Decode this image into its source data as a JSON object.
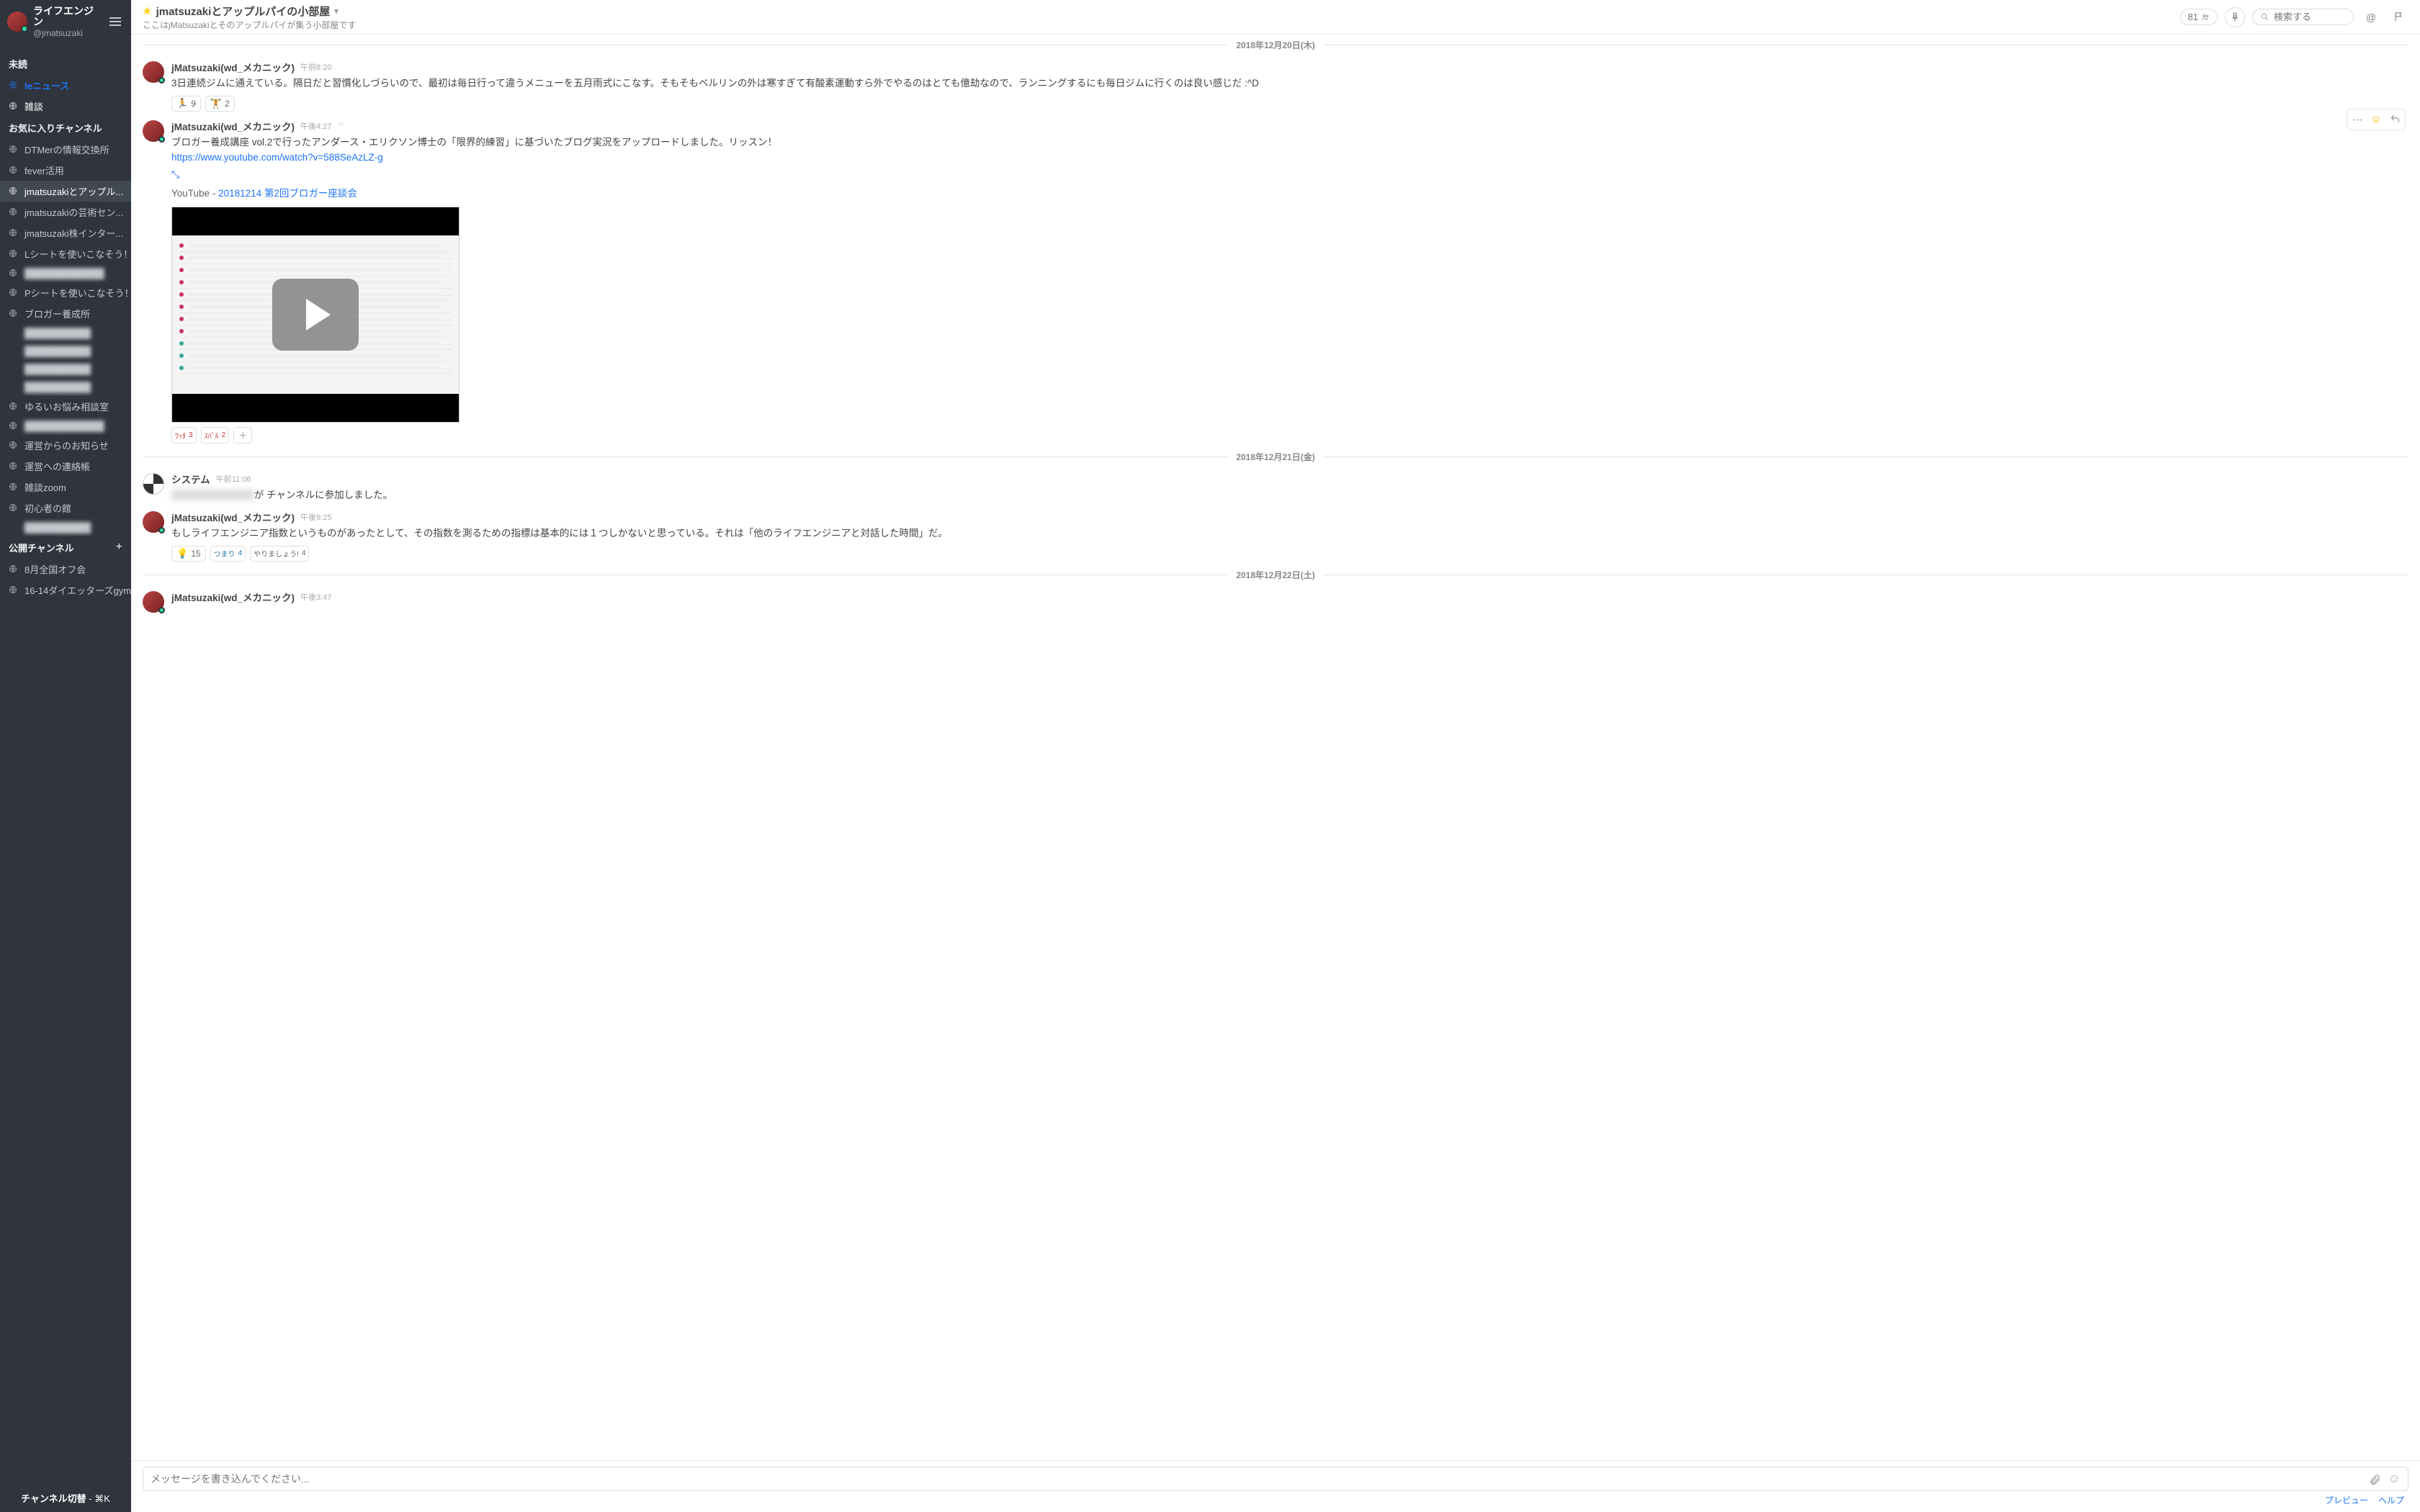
{
  "workspace": {
    "title": "ライフエンジン",
    "handle": "@jmatsuzaki"
  },
  "sidebar": {
    "sections": [
      {
        "title": "未読",
        "items": [
          {
            "label": "leニュース",
            "highlight": true,
            "icon": "globe"
          },
          {
            "label": "雑談",
            "unread": true,
            "icon": "globe"
          }
        ]
      },
      {
        "title": "お気に入りチャンネル",
        "items": [
          {
            "label": "DTMerの情報交換所",
            "icon": "globe"
          },
          {
            "label": "fever活用",
            "icon": "globe"
          },
          {
            "label": "jmatsuzakiとアップル...",
            "icon": "globe",
            "active": true
          },
          {
            "label": "jmatsuzakiの芸術セン...",
            "icon": "globe"
          },
          {
            "label": "jmatsuzaki株インター...",
            "icon": "globe"
          },
          {
            "label": "Lシートを使いこなそう！",
            "icon": "globe"
          },
          {
            "label": "████████████",
            "icon": "globe",
            "blur": true
          },
          {
            "label": "Pシートを使いこなそう！",
            "icon": "globe"
          },
          {
            "label": "ブロガー養成所",
            "icon": "globe"
          },
          {
            "label": "██████████",
            "icon": "none",
            "blur": true
          },
          {
            "label": "██████████",
            "icon": "none",
            "blur": true
          },
          {
            "label": "██████████",
            "icon": "none",
            "blur": true
          },
          {
            "label": "██████████",
            "icon": "none",
            "blur": true
          },
          {
            "label": "ゆるいお悩み相談室",
            "icon": "globe"
          },
          {
            "label": "████████████",
            "icon": "globe",
            "blur": true
          },
          {
            "label": "運営からのお知らせ",
            "icon": "globe"
          },
          {
            "label": "運営への連絡帳",
            "icon": "globe"
          },
          {
            "label": "雑談zoom",
            "icon": "globe"
          },
          {
            "label": "初心者の館",
            "icon": "globe"
          },
          {
            "label": "██████████",
            "icon": "none",
            "blur": true
          }
        ]
      },
      {
        "title": "公開チャンネル",
        "plus": true,
        "items": [
          {
            "label": "8月全国オフ会",
            "icon": "globe"
          },
          {
            "label": "16-14ダイエッターズgym",
            "icon": "globe"
          }
        ]
      }
    ],
    "footer": {
      "label": "チャンネル切替",
      "shortcut": " - ⌘K"
    }
  },
  "header": {
    "channel_title": "jmatsuzakiとアップルパイの小部屋",
    "topic": "ここはjMatsuzakiとそのアップルパイが集う小部屋です",
    "member_count": "81",
    "search_placeholder": "検索する"
  },
  "dates": {
    "d1": "2018年12月20日(木)",
    "d2": "2018年12月21日(金)",
    "d3": "2018年12月22日(土)"
  },
  "messages": {
    "m1": {
      "user": "jMatsuzaki(wd_メカニック)",
      "time": "午前8:20",
      "text": "3日連続ジムに通えている。隔日だと習慣化しづらいので、最初は毎日行って違うメニューを五月雨式にこなす。そもそもベルリンの外は寒すぎて有酸素運動すら外でやるのはとても億劫なので、ランニングするにも毎日ジムに行くのは良い感じだ :^D",
      "reactions": [
        {
          "emoji": "🏃",
          "count": "9"
        },
        {
          "emoji": "🏋️",
          "count": "2"
        }
      ]
    },
    "m2": {
      "user": "jMatsuzaki(wd_メカニック)",
      "time": "午後4:27",
      "text": "ブロガー養成講座 vol.2で行ったアンダース・エリクソン博士の「限界的練習」に基づいたブログ実況をアップロードしました。リッスン！",
      "link_url": "https://www.youtube.com/watch?v=588SeAzLZ-g",
      "attach_source": "YouTube - ",
      "attach_title": "20181214 第2回ブロガー座談会",
      "reactions": [
        {
          "emoji_text": "ﾜｯﾀ",
          "count": "3"
        },
        {
          "emoji_text": "ｽﾊﾞﾙ",
          "count": "2"
        }
      ]
    },
    "m3": {
      "user": "システム",
      "time": "午前11:06",
      "blurred_user": "████████████",
      "text_suffix": "が チャンネルに参加しました。"
    },
    "m4": {
      "user": "jMatsuzaki(wd_メカニック)",
      "time": "午後9:25",
      "text": "もしライフエンジニア指数というものがあったとして、その指数を測るための指標は基本的には１つしかないと思っている。それは「他のライフエンジニアと対話した時間」だ。",
      "reactions": [
        {
          "emoji": "💡",
          "count": "15"
        },
        {
          "emoji_text": "つまり",
          "count": "4"
        },
        {
          "emoji_text": "やりましょう!",
          "count": "4"
        }
      ]
    },
    "m5": {
      "user": "jMatsuzaki(wd_メカニック)",
      "time": "午後3:47"
    }
  },
  "composer": {
    "placeholder": "メッセージを書き込んでください...",
    "preview": "プレビュー",
    "help": "ヘルプ"
  }
}
